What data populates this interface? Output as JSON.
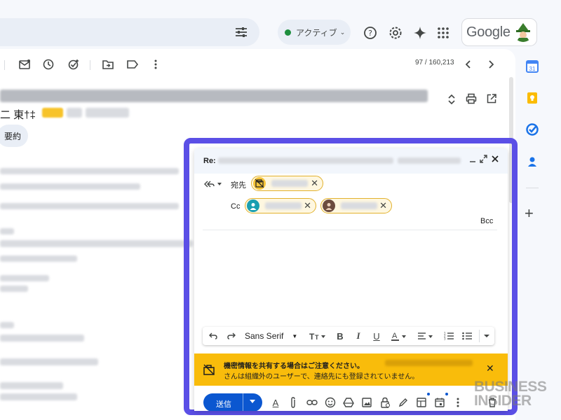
{
  "topbar": {
    "status_label": "アクティブ",
    "google_label": "Google"
  },
  "toolbar": {
    "pager": "97 / 160,213"
  },
  "thread": {
    "subject_fragment": "二 東†‡",
    "summary_chip": "要約"
  },
  "compose": {
    "header_label": "Re:",
    "to_label": "宛先",
    "cc_label": "Cc",
    "bcc_label": "Bcc",
    "format": {
      "font_name": "Sans Serif"
    },
    "warning": {
      "title": "機密情報を共有する場合はご注意ください。",
      "subtitle": "さんは組織外のユーザーで、連絡先にも登録されていません。"
    },
    "send_label": "送信"
  },
  "watermark": {
    "line1": "BUSINESS",
    "line2": "INSIDER"
  },
  "colors": {
    "highlight": "#5b4fe6",
    "warning_bg": "#f9bc0b",
    "send_button": "#0b57d0",
    "chip_border": "#e2b12d",
    "status_dot": "#1e8e3e"
  }
}
